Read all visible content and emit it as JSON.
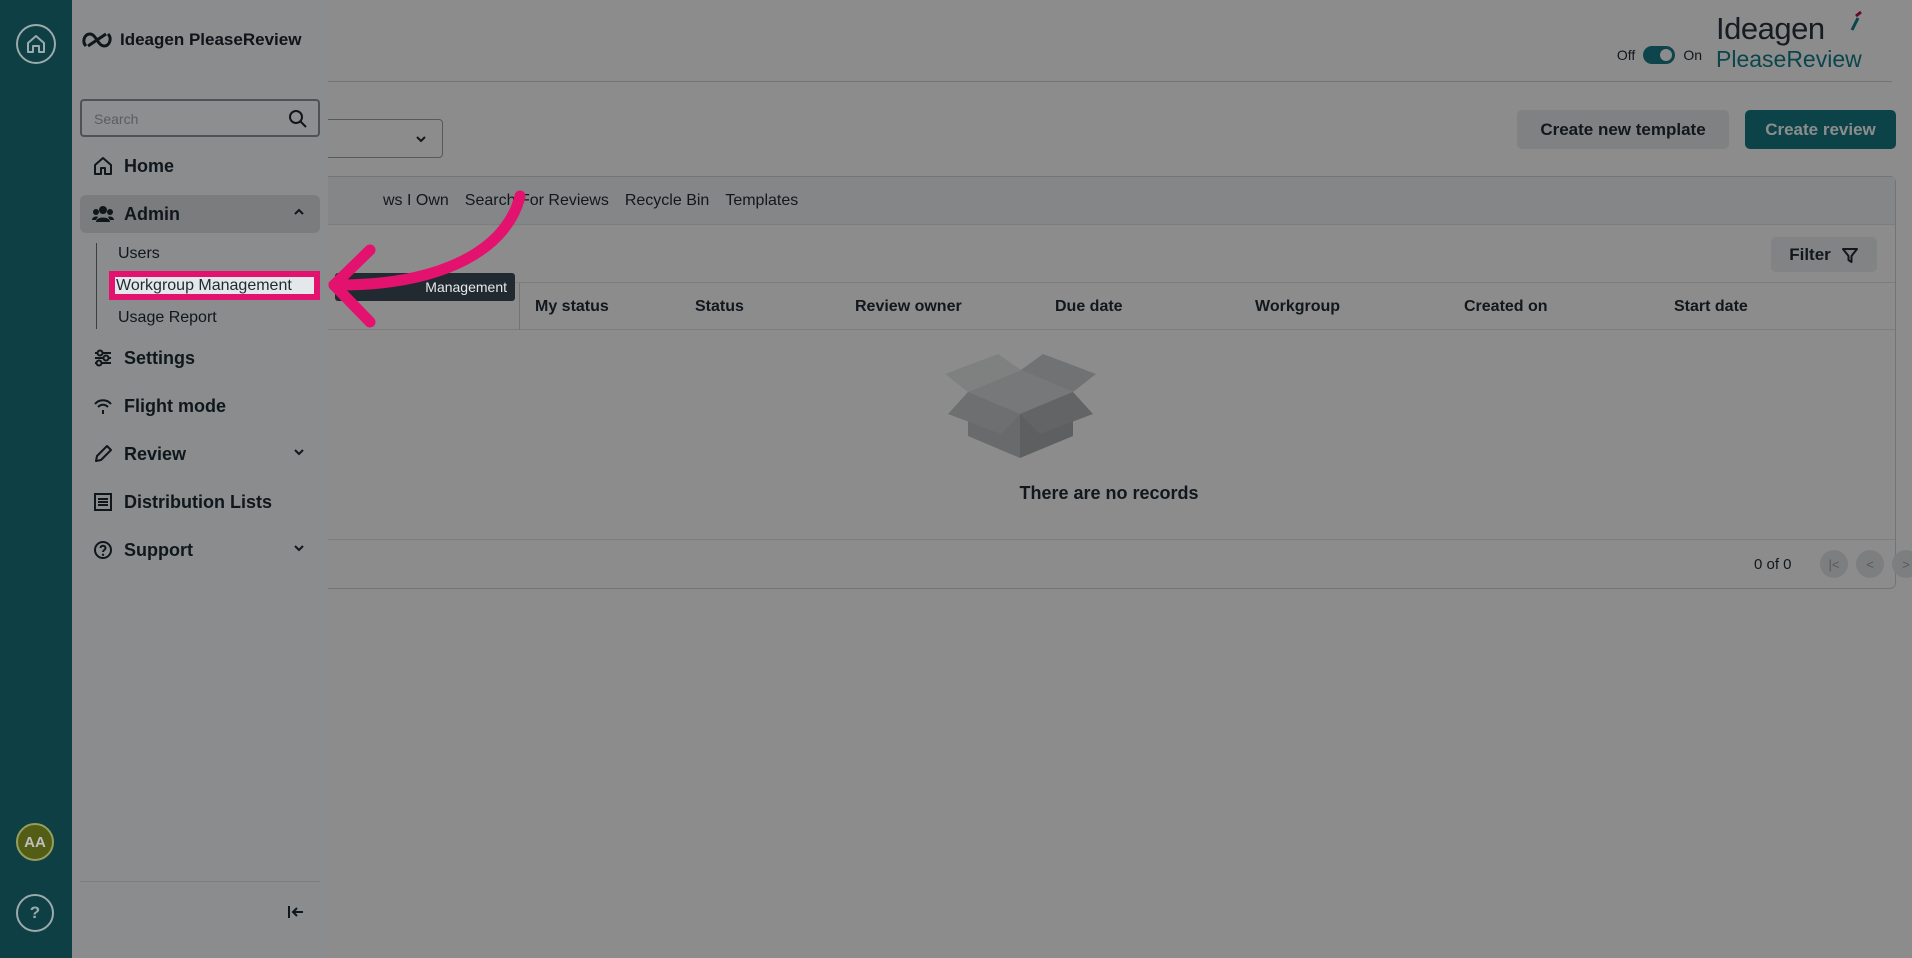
{
  "app": {
    "title": "Ideagen PleaseReview",
    "brand_line1": "Ideagen",
    "brand_line2": "PleaseReview"
  },
  "topbar": {
    "toggle_off": "Off",
    "toggle_on": "On",
    "toggle_state": "on"
  },
  "actions": {
    "create_template": "Create new template",
    "create_review": "Create review"
  },
  "tabs": [
    "ws I Own",
    "Search For Reviews",
    "Recycle Bin",
    "Templates"
  ],
  "filter": {
    "label": "Filter"
  },
  "table": {
    "columns": [
      "My status",
      "Status",
      "Review owner",
      "Due date",
      "Workgroup",
      "Created on",
      "Start date"
    ],
    "empty_text": "There are no records",
    "count": "0 of 0"
  },
  "drawer": {
    "title": "Ideagen PleaseReview",
    "search_placeholder": "Search",
    "items": {
      "home": "Home",
      "admin": "Admin",
      "settings": "Settings",
      "flight_mode": "Flight mode",
      "review": "Review",
      "distribution_lists": "Distribution Lists",
      "support": "Support"
    },
    "admin_sub": {
      "users": "Users",
      "workgroup_management": "Workgroup Management",
      "usage_report": "Usage Report"
    }
  },
  "tooltip": {
    "text": "Management"
  },
  "rail": {
    "avatar_initials": "AA",
    "help": "?"
  },
  "colors": {
    "primary": "#147b85",
    "rail": "#12545b",
    "highlight": "#e3126e",
    "avatar": "#6f7d1e"
  }
}
